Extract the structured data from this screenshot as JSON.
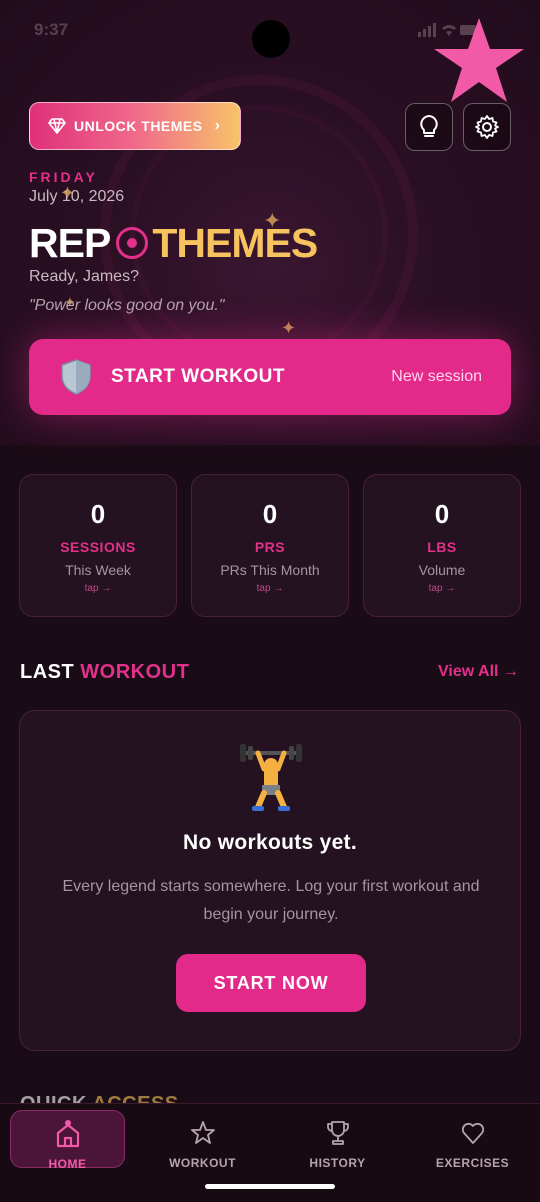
{
  "status_bar": {
    "time": "9:37"
  },
  "header": {
    "unlock_label": "UNLOCK THEMES",
    "unlock_chevron": "›",
    "day": "FRIDAY",
    "date": "July 10, 2026",
    "logo_left": "REP",
    "logo_right": "THEMES",
    "greeting": "Ready, James?",
    "quote": "\"Power looks good on you.\""
  },
  "start_workout": {
    "label": "START WORKOUT",
    "sub": "New session"
  },
  "stats": [
    {
      "value": "0",
      "key": "SESSIONS",
      "desc": "This Week",
      "tap": "tap →"
    },
    {
      "value": "0",
      "key": "PRS",
      "desc": "PRs This Month",
      "tap": "tap →"
    },
    {
      "value": "0",
      "key": "LBS",
      "desc": "Volume",
      "tap": "tap →"
    }
  ],
  "last_workout": {
    "title_a": "LAST",
    "title_b": "WORKOUT",
    "view_all": "View All →",
    "empty_title": "No workouts yet.",
    "empty_text": "Every legend starts somewhere. Log your first workout and begin your journey.",
    "start_now": "START NOW"
  },
  "quick_access": {
    "a": "QUICK",
    "b": "ACCESS"
  },
  "nav": {
    "items": [
      {
        "label": "HOME",
        "icon": "home-icon",
        "active": true
      },
      {
        "label": "WORKOUT",
        "icon": "star-icon",
        "active": false
      },
      {
        "label": "HISTORY",
        "icon": "trophy-icon",
        "active": false
      },
      {
        "label": "EXERCISES",
        "icon": "heart-icon",
        "active": false
      }
    ]
  },
  "colors": {
    "accent": "#e32a8a",
    "gold": "#f7c35f",
    "background": "#1a0c16",
    "card": "#241220"
  }
}
